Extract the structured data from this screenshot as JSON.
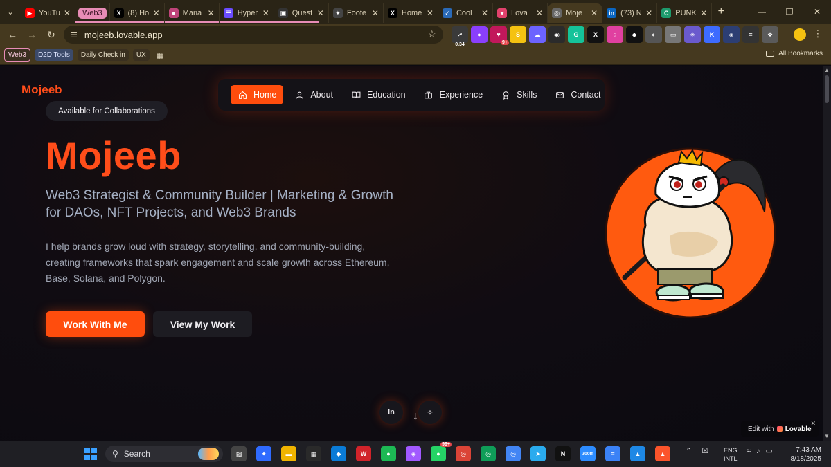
{
  "browser": {
    "tab_group": "Web3",
    "tabs": [
      {
        "label": "YouTube",
        "fav": "▶",
        "color": "#ff0000"
      },
      {
        "label": "(8) Ho",
        "fav": "X",
        "color": "#000000"
      },
      {
        "label": "Maria",
        "fav": "●",
        "color": "#c0447a"
      },
      {
        "label": "Hyper",
        "fav": "☰",
        "color": "#6a4cff"
      },
      {
        "label": "Quest",
        "fav": "▣",
        "color": "#333333"
      },
      {
        "label": "Foote",
        "fav": "✦",
        "color": "#444444"
      },
      {
        "label": "Home",
        "fav": "X",
        "color": "#000000"
      },
      {
        "label": "Cool",
        "fav": "✓",
        "color": "#2a6ab8"
      },
      {
        "label": "Lova",
        "fav": "♥",
        "color": "#e2426c"
      },
      {
        "label": "Moje",
        "fav": "◎",
        "color": "#666666",
        "active": true
      },
      {
        "label": "(73) N",
        "fav": "in",
        "color": "#0a66c2"
      },
      {
        "label": "PUNK",
        "fav": "C",
        "color": "#1d9a6c"
      }
    ],
    "new_tab": "+",
    "url": "mojeeb.lovable.app",
    "extensions": [
      {
        "label": "↗",
        "color": "#3a3a3a",
        "sub": "0.34"
      },
      {
        "label": "●",
        "color": "#8a3ffc"
      },
      {
        "label": "♥",
        "color": "#c2185b",
        "badge": "9+"
      },
      {
        "label": "S",
        "color": "#f5c211"
      },
      {
        "label": "☁",
        "color": "#6c63ff"
      },
      {
        "label": "◉",
        "color": "#2b2b2b"
      },
      {
        "label": "G",
        "color": "#15c39a"
      },
      {
        "label": "X",
        "color": "#111111"
      },
      {
        "label": "○",
        "color": "#e040a0"
      },
      {
        "label": "◆",
        "color": "#111111"
      },
      {
        "label": "◐",
        "color": "#555555"
      },
      {
        "label": "▭",
        "color": "#777777"
      },
      {
        "label": "✳",
        "color": "#6a5acd"
      },
      {
        "label": "K",
        "color": "#3d6bff"
      },
      {
        "label": "◈",
        "color": "#2c3e73"
      },
      {
        "label": "≡",
        "color": "#333333"
      },
      {
        "label": "❖",
        "color": "#5a5a5a"
      }
    ],
    "bookmarks": [
      "Web3",
      "D2D Tools",
      "Daily Check in",
      "UX"
    ],
    "all_bookmarks": "All Bookmarks"
  },
  "page": {
    "logo": "Mojeeb",
    "nav": [
      {
        "label": "Home",
        "icon": "home-icon",
        "active": true
      },
      {
        "label": "About",
        "icon": "user-icon"
      },
      {
        "label": "Education",
        "icon": "book-icon"
      },
      {
        "label": "Experience",
        "icon": "briefcase-icon"
      },
      {
        "label": "Skills",
        "icon": "award-icon"
      },
      {
        "label": "Contact",
        "icon": "mail-icon"
      }
    ],
    "badge": "Available for Collaborations",
    "title": "Mojeeb",
    "subtitle": "Web3 Strategist & Community Builder | Marketing & Growth for DAOs, NFT Projects, and Web3 Brands",
    "description": "I help brands grow loud with strategy, storytelling, and community-building, creating frameworks that spark engagement and scale growth across Ethereum, Base, Solana, and Polygon.",
    "primary_button": "Work With Me",
    "secondary_button": "View My Work",
    "social": [
      {
        "label": "in",
        "icon": "linkedin-icon"
      },
      {
        "label": "✧",
        "icon": "twitter-icon"
      }
    ],
    "scroll_hint": "↓",
    "edit_prefix": "Edit with",
    "edit_brand": "Lovable",
    "accent_color": "#ff4d0d"
  },
  "taskbar": {
    "search_placeholder": "Search",
    "apps": [
      {
        "label": "▨",
        "color": "#444444"
      },
      {
        "label": "✦",
        "color": "#2f6bff"
      },
      {
        "label": "▬",
        "color": "#f0b400"
      },
      {
        "label": "▦",
        "color": "#2a2a2a"
      },
      {
        "label": "◆",
        "color": "#0a7bd6"
      },
      {
        "label": "W",
        "color": "#d1232a"
      },
      {
        "label": "●",
        "color": "#1db954"
      },
      {
        "label": "◈",
        "color": "#a259ff"
      },
      {
        "label": "●",
        "color": "#25d366",
        "badge": "99+"
      },
      {
        "label": "◎",
        "color": "#db4437"
      },
      {
        "label": "◎",
        "color": "#0f9d58"
      },
      {
        "label": "◎",
        "color": "#4285f4"
      },
      {
        "label": "➤",
        "color": "#2aabee"
      },
      {
        "label": "N",
        "color": "#111111"
      },
      {
        "label": "zoom",
        "color": "#2d8cff"
      },
      {
        "label": "≡",
        "color": "#3b82f6"
      },
      {
        "label": "▲",
        "color": "#1e88e5"
      },
      {
        "label": "▲",
        "color": "#fb542b"
      }
    ],
    "lang_line1": "ENG",
    "lang_line2": "INTL",
    "time": "7:43 AM",
    "date": "8/18/2025"
  }
}
